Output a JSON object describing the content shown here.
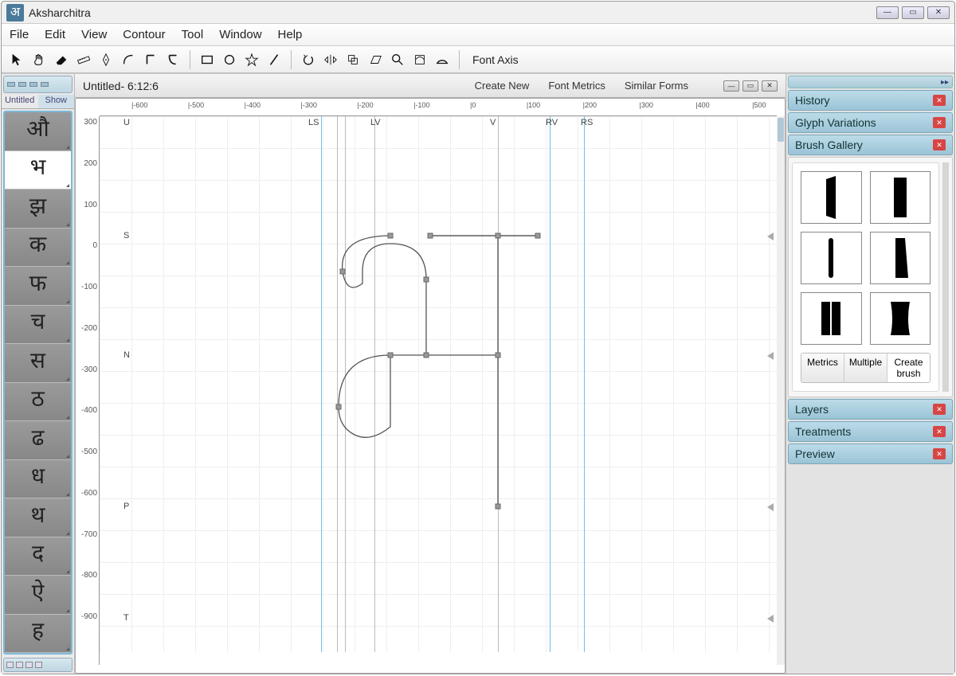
{
  "app": {
    "title": "Aksharchitra",
    "icon_glyph": "अ"
  },
  "window_controls": {
    "min": "—",
    "max": "▭",
    "close": "✕"
  },
  "menubar": [
    "File",
    "Edit",
    "View",
    "Contour",
    "Tool",
    "Window",
    "Help"
  ],
  "toolbar": {
    "tools": [
      "pointer",
      "hand",
      "eraser",
      "ruler",
      "pen",
      "curve",
      "corner-left",
      "corner-right",
      "rect",
      "circle",
      "star",
      "line",
      "undo",
      "mirror",
      "copybox",
      "skew",
      "zoom",
      "clip",
      "half-circle"
    ],
    "font_axis_label": "Font Axis"
  },
  "left_panel": {
    "tabs": {
      "untitled": "Untitled",
      "show": "Show"
    },
    "glyphs": [
      "औ",
      "भ",
      "झ",
      "क",
      "फ",
      "च",
      "स",
      "ठ",
      "ढ",
      "ध",
      "थ",
      "द",
      "ऐ",
      "ह"
    ],
    "selected_index": 1
  },
  "center": {
    "doc_title": "Untitled-  6:12:6",
    "actions": {
      "create_new": "Create New",
      "font_metrics": "Font Metrics",
      "similar_forms": "Similar Forms"
    },
    "ruler_x": [
      -600,
      -500,
      -400,
      -300,
      -200,
      -100,
      0,
      100,
      200,
      300,
      400,
      500
    ],
    "ruler_y": [
      300,
      200,
      100,
      0,
      -100,
      -200,
      -300,
      -400,
      -500,
      -600,
      -700,
      -800,
      -900
    ],
    "markers": {
      "U": "U",
      "S": "S",
      "N": "N",
      "P": "P",
      "T": "T",
      "LS": "LS",
      "LV": "LV",
      "V": "V",
      "RV": "RV",
      "RS": "RS"
    }
  },
  "right_panel": {
    "top_arrows": "▸▸",
    "panels": {
      "history": "History",
      "glyph_variations": "Glyph Variations",
      "brush_gallery": "Brush Gallery",
      "layers": "Layers",
      "treatments": "Treatments",
      "preview": "Preview"
    },
    "brush_buttons": {
      "metrics": "Metrics",
      "multiple": "Multiple",
      "create": "Create brush"
    }
  }
}
